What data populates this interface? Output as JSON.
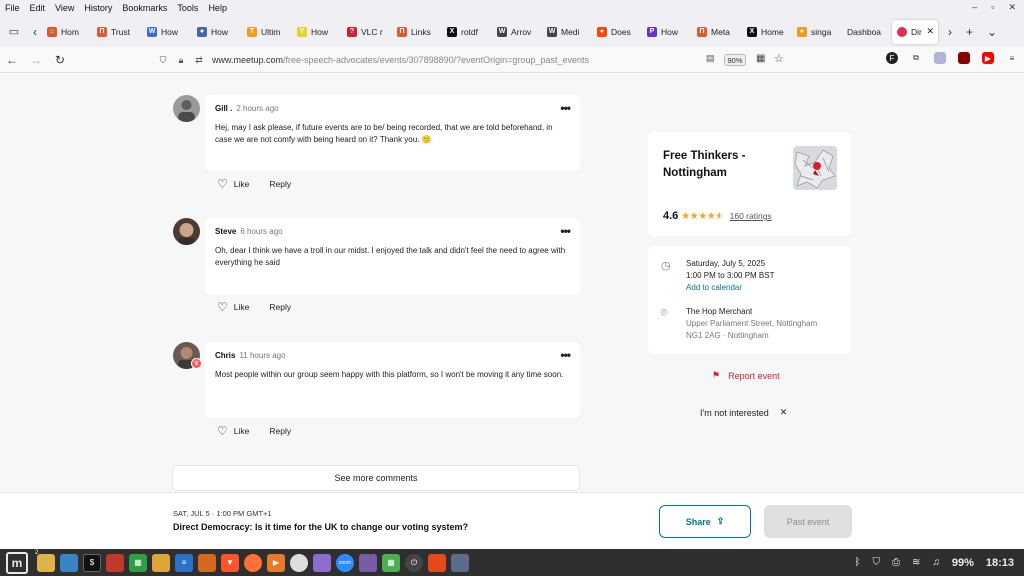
{
  "menu": [
    "File",
    "Edit",
    "View",
    "History",
    "Bookmarks",
    "Tools",
    "Help"
  ],
  "tabs": [
    {
      "label": "Hom",
      "color": "#e05a2b",
      "glyph": "⌂"
    },
    {
      "label": "Trust",
      "color": "#e05a2b",
      "glyph": "П"
    },
    {
      "label": "How",
      "color": "#3d6ad6",
      "glyph": "W"
    },
    {
      "label": "How",
      "color": "#4466aa",
      "glyph": "●"
    },
    {
      "label": "Ultim",
      "color": "#f29c1f",
      "glyph": "T"
    },
    {
      "label": "How",
      "color": "#e8d12a",
      "glyph": "Y"
    },
    {
      "label": "VLC r",
      "color": "#cc2233",
      "glyph": "?"
    },
    {
      "label": "Links",
      "color": "#e05a2b",
      "glyph": "П"
    },
    {
      "label": "rotdf",
      "color": "#111111",
      "glyph": "X"
    },
    {
      "label": "Arrov",
      "color": "#444444",
      "glyph": "W"
    },
    {
      "label": "Medi",
      "color": "#444444",
      "glyph": "W"
    },
    {
      "label": "Does",
      "color": "#ff4500",
      "glyph": "●"
    },
    {
      "label": "How",
      "color": "#6b2fd6",
      "glyph": "P"
    },
    {
      "label": "Meta",
      "color": "#e05a2b",
      "glyph": "П"
    },
    {
      "label": "Home",
      "color": "#111111",
      "glyph": "X"
    },
    {
      "label": "singa",
      "color": "#f29c1f",
      "glyph": "●"
    },
    {
      "label": "Dashboa",
      "color": "#f0f0f4",
      "glyph": ""
    }
  ],
  "active_tab": {
    "label": "Dir",
    "color": "#e0314a"
  },
  "url": {
    "domain": "www.meetup.com",
    "path": "/free-speech-advocates/events/307898890/?eventOrigin=group_past_events",
    "zoom": "90%"
  },
  "comments": [
    {
      "name": "Gill .",
      "time": "2 hours ago",
      "text": "Hej, may I ask please, if future events are to be/ being recorded, that we are told beforehand, in case we are not comfy with being heard on it? Thank you. 🙂",
      "avatar_color": "#8a8a8a"
    },
    {
      "name": "Steve",
      "time": "6 hours ago",
      "text": "Oh, dear I think we have a troll in our midst. I enjoyed the talk and didn't feel the need to agree with everything he said",
      "avatar_color": "#7a6a5a"
    },
    {
      "name": "Chris",
      "time": "11 hours ago",
      "text": "Most people within our group seem happy with this platform, so I won't be moving it any time soon.",
      "avatar_color": "#5c4a40"
    }
  ],
  "actions": {
    "like": "Like",
    "reply": "Reply"
  },
  "see_more": "See more comments",
  "group": {
    "name": "Free Thinkers - Nottingham",
    "rating": "4.6",
    "rating_stars": 4.6,
    "stars": "★★★★★",
    "ratings_count": "160 ratings"
  },
  "event": {
    "date": "Saturday, July 5, 2025",
    "time": "1:00 PM to 3:00 PM BST",
    "add_calendar": "Add to calendar",
    "venue": "The Hop Merchant",
    "address1": "Upper Parliament Street, Nottingham",
    "address2": "NG1 2AG · Nottingham"
  },
  "report": "Report event",
  "not_interested": "I'm not interested",
  "bottom": {
    "date": "SAT, JUL 5 · 1:00 PM GMT+1",
    "title": "Direct Democracy: Is it time for the UK to change our voting system?",
    "share": "Share",
    "past": "Past event"
  },
  "tray": {
    "battery": "99%",
    "clock": "18:13",
    "badge": "2"
  },
  "colors": {
    "accent": "#00798a",
    "danger": "#d1242f",
    "star": "#f5a623"
  }
}
